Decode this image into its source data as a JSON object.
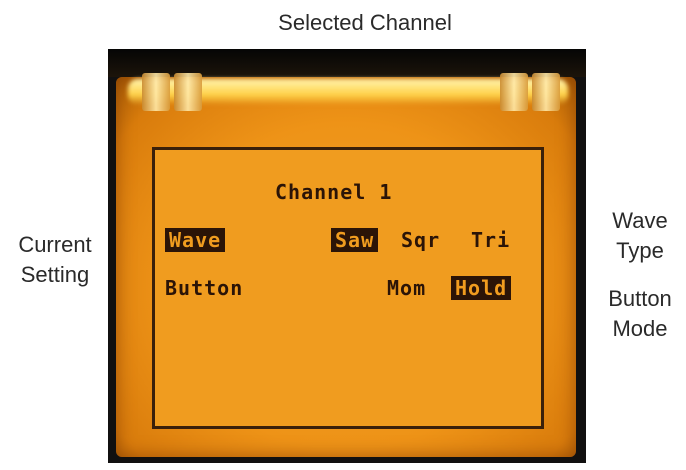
{
  "annotations": {
    "selected_channel": "Selected Channel",
    "current_setting_line1": "Current",
    "current_setting_line2": "Setting",
    "wave_type_line1": "Wave",
    "wave_type_line2": "Type",
    "button_mode_line1": "Button",
    "button_mode_line2": "Mode"
  },
  "lcd": {
    "title": "Channel 1",
    "setting_wave": "Wave",
    "setting_button": "Button",
    "wave_options": [
      "Saw",
      "Sqr",
      "Tri"
    ],
    "wave_selected": "Saw",
    "button_options": [
      "Mom",
      "Hold"
    ],
    "button_selected": "Hold"
  },
  "colors": {
    "backlight": "#f09c1f",
    "lcd_ink": "#2b1407"
  }
}
